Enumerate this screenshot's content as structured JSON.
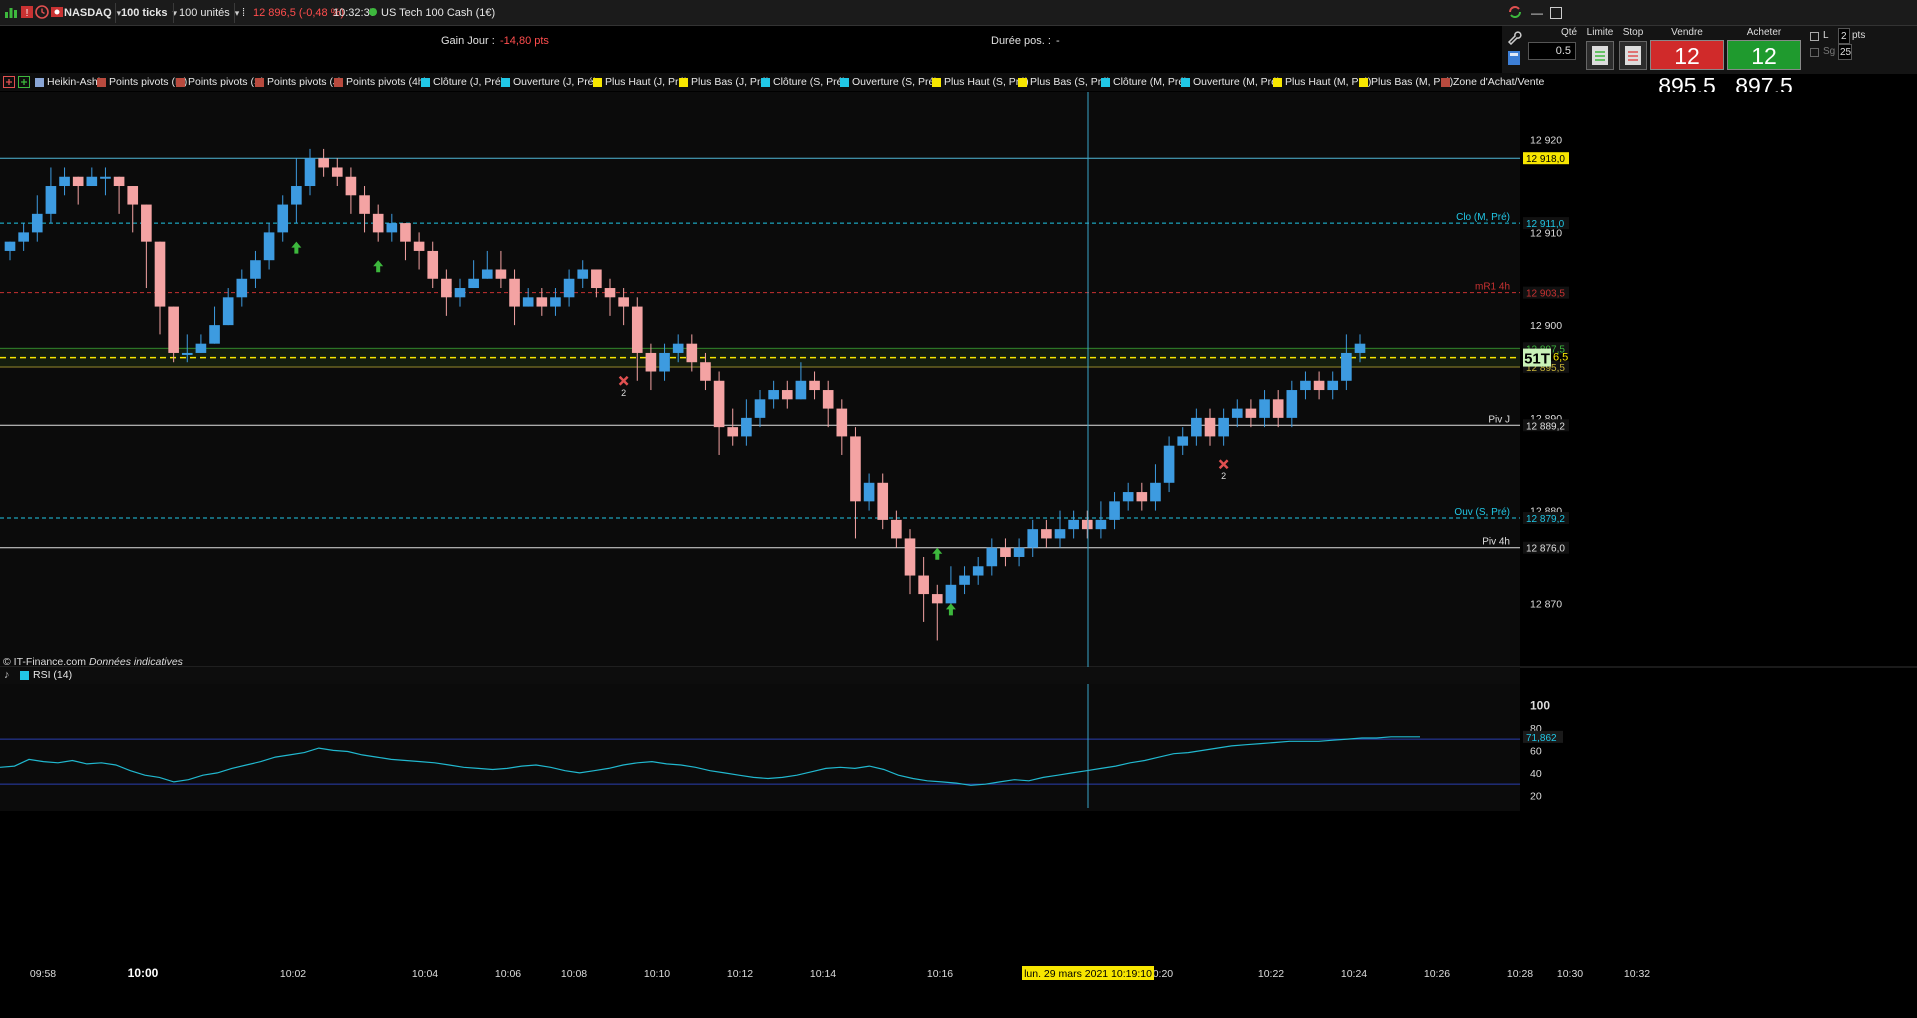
{
  "toolbar": {
    "instrument": "NASDAQ",
    "timeframe": "100 ticks",
    "units": "100 unités",
    "price_change": "12 896,5 (-0,48 %)",
    "clock": "10:32:37",
    "product_name": "US Tech 100 Cash (1€)"
  },
  "info": {
    "gain_label": "Gain Jour :",
    "gain_value": "-14,80 pts",
    "duration_label": "Durée pos. :",
    "duration_value": "-"
  },
  "order_panel": {
    "qty_label": "Qté",
    "qty_value": "0.5",
    "limit_label": "Limite",
    "stop_label": "Stop",
    "sell_label": "Vendre",
    "sell_price": "12 895,5",
    "buy_label": "Acheter",
    "buy_price": "12 897,5",
    "l_label": "L",
    "sg_label": "Sg",
    "pts_value": "2",
    "pts_label": "pts",
    "sg_value": "25"
  },
  "indicators": [
    {
      "label": "Heikin-Ashi",
      "color": "#8aa6d6"
    },
    {
      "label": "Points pivots (M)",
      "color": "#b84a3e"
    },
    {
      "label": "Points pivots (S)",
      "color": "#b84a3e"
    },
    {
      "label": "Points pivots (J)",
      "color": "#b84a3e"
    },
    {
      "label": "Points pivots (4h)",
      "color": "#b84a3e"
    },
    {
      "label": "Clôture (J, Pré)",
      "color": "#21c7e6"
    },
    {
      "label": "Ouverture (J, Pré)",
      "color": "#21c7e6"
    },
    {
      "label": "Plus Haut (J, Pré)",
      "color": "#f7e600"
    },
    {
      "label": "Plus Bas (J, Pré)",
      "color": "#f7e600"
    },
    {
      "label": "Clôture (S, Pré)",
      "color": "#21c7e6"
    },
    {
      "label": "Ouverture (S, Pré)",
      "color": "#21c7e6"
    },
    {
      "label": "Plus Haut (S, Pré)",
      "color": "#f7e600"
    },
    {
      "label": "Plus Bas (S, Pré)",
      "color": "#f7e600"
    },
    {
      "label": "Clôture (M, Pré)",
      "color": "#21c7e6"
    },
    {
      "label": "Ouverture (M, Pré)",
      "color": "#21c7e6"
    },
    {
      "label": "Plus Haut (M, Pré)",
      "color": "#f7e600"
    },
    {
      "label": "Plus Bas (M, Pré)",
      "color": "#f7e600"
    },
    {
      "label": "Zone d'Achat/Vente",
      "color": "#b84a3e"
    }
  ],
  "chart": {
    "copyright": "© IT-Finance.com",
    "disclaimer": "Données indicatives",
    "rsi_label": "RSI (14)",
    "crosshair_date": "lun. 29 mars 2021 10:19:10",
    "price_axis": [
      "12 920",
      "12 910",
      "12 900",
      "12 890",
      "12 880",
      "12 870"
    ],
    "price_ticks": [
      12920,
      12910,
      12900,
      12890,
      12880,
      12870
    ],
    "rsi_axis": [
      "100",
      "80",
      "60",
      "40",
      "20"
    ],
    "rsi_ticks": [
      100,
      80,
      60,
      40,
      20
    ],
    "rsi_current": "71,862",
    "time_axis": [
      "09:58",
      "10:00",
      "10:02",
      "10:04",
      "10:06",
      "10:08",
      "10:10",
      "10:12",
      "10:14",
      "10:16",
      "10:20",
      "10:22",
      "10:24",
      "10:26",
      "10:28",
      "10:30",
      "10:32"
    ],
    "levels": [
      {
        "label": "",
        "tag": "12 918,0",
        "value": 12918.0,
        "color": "#4fb8d6",
        "style": "solid",
        "tag_bg": "#f7e600",
        "tag_fg": "#000"
      },
      {
        "label": "Clo (M, Pré)",
        "tag": "12 911,0",
        "value": 12911.0,
        "color": "#21c7e6",
        "style": "dashed",
        "tag_bg": "#111",
        "tag_fg": "#21c7e6"
      },
      {
        "label": "mR1 4h",
        "tag": "12 903,5",
        "value": 12903.5,
        "color": "#c83232",
        "style": "dashed",
        "tag_bg": "#111",
        "tag_fg": "#c83232"
      },
      {
        "label": "",
        "tag": "12 897,5",
        "value": 12897.5,
        "color": "#3db83d",
        "style": "solid",
        "tag_bg": "#111",
        "tag_fg": "#3db83d"
      },
      {
        "label": "",
        "tag": "12 895,5",
        "value": 12895.5,
        "color": "#c8b43a",
        "style": "solid",
        "tag_bg": "#111",
        "tag_fg": "#c8b43a"
      },
      {
        "label": "Piv J",
        "tag": "12 889,2",
        "value": 12889.2,
        "color": "#e0e0e0",
        "style": "solid",
        "tag_bg": "#111",
        "tag_fg": "#e0e0e0"
      },
      {
        "label": "Ouv (S, Pré)",
        "tag": "12 879,2",
        "value": 12879.2,
        "color": "#21c7e6",
        "style": "dashed",
        "tag_bg": "#111",
        "tag_fg": "#21c7e6"
      },
      {
        "label": "Piv 4h",
        "tag": "12 876,0",
        "value": 12876.0,
        "color": "#e0e0e0",
        "style": "solid",
        "tag_bg": "#111",
        "tag_fg": "#e0e0e0"
      }
    ],
    "current_price_box": "51T",
    "current_price_suffix": "6,5",
    "current_price": 12896.5,
    "bull_color": "#3d9be0",
    "bear_color": "#f4a3a3",
    "candles": [
      [
        12908,
        12909,
        12909,
        12907
      ],
      [
        12909,
        12910,
        12911,
        12908
      ],
      [
        12910,
        12912,
        12914,
        12909
      ],
      [
        12912,
        12915,
        12917,
        12911
      ],
      [
        12915,
        12916,
        12917,
        12914
      ],
      [
        12916,
        12915,
        12916,
        12913
      ],
      [
        12915,
        12916,
        12917,
        12915
      ],
      [
        12916,
        12916,
        12917,
        12914
      ],
      [
        12916,
        12915,
        12916,
        12912
      ],
      [
        12915,
        12913,
        12915,
        12910
      ],
      [
        12913,
        12909,
        12913,
        12904
      ],
      [
        12909,
        12902,
        12909,
        12899
      ],
      [
        12902,
        12897,
        12902,
        12896
      ],
      [
        12897,
        12897,
        12899,
        12896
      ],
      [
        12897,
        12898,
        12899,
        12897
      ],
      [
        12898,
        12900,
        12902,
        12898
      ],
      [
        12900,
        12903,
        12904,
        12900
      ],
      [
        12903,
        12905,
        12906,
        12902
      ],
      [
        12905,
        12907,
        12908,
        12904
      ],
      [
        12907,
        12910,
        12911,
        12906
      ],
      [
        12910,
        12913,
        12914,
        12909
      ],
      [
        12913,
        12915,
        12918,
        12911
      ],
      [
        12915,
        12918,
        12919,
        12914
      ],
      [
        12918,
        12917,
        12919,
        12916
      ],
      [
        12917,
        12916,
        12918,
        12915
      ],
      [
        12916,
        12914,
        12917,
        12912
      ],
      [
        12914,
        12912,
        12915,
        12910
      ],
      [
        12912,
        12910,
        12913,
        12909
      ],
      [
        12910,
        12911,
        12912,
        12909
      ],
      [
        12911,
        12909,
        12911,
        12907
      ],
      [
        12909,
        12908,
        12910,
        12906
      ],
      [
        12908,
        12905,
        12909,
        12904
      ],
      [
        12905,
        12903,
        12906,
        12901
      ],
      [
        12903,
        12904,
        12905,
        12902
      ],
      [
        12904,
        12905,
        12907,
        12904
      ],
      [
        12905,
        12906,
        12908,
        12905
      ],
      [
        12906,
        12905,
        12908,
        12904
      ],
      [
        12905,
        12902,
        12906,
        12900
      ],
      [
        12902,
        12903,
        12904,
        12902
      ],
      [
        12903,
        12902,
        12904,
        12901
      ],
      [
        12902,
        12903,
        12904,
        12901
      ],
      [
        12903,
        12905,
        12906,
        12902
      ],
      [
        12905,
        12906,
        12907,
        12904
      ],
      [
        12906,
        12904,
        12906,
        12903
      ],
      [
        12904,
        12903,
        12905,
        12901
      ],
      [
        12903,
        12902,
        12904,
        12900
      ],
      [
        12902,
        12897,
        12903,
        12894
      ],
      [
        12897,
        12895,
        12898,
        12893
      ],
      [
        12895,
        12897,
        12898,
        12894
      ],
      [
        12897,
        12898,
        12899,
        12896
      ],
      [
        12898,
        12896,
        12899,
        12895
      ],
      [
        12896,
        12894,
        12897,
        12893
      ],
      [
        12894,
        12889,
        12895,
        12886
      ],
      [
        12889,
        12888,
        12891,
        12887
      ],
      [
        12888,
        12890,
        12892,
        12887
      ],
      [
        12890,
        12892,
        12893,
        12889
      ],
      [
        12892,
        12893,
        12894,
        12891
      ],
      [
        12893,
        12892,
        12894,
        12891
      ],
      [
        12892,
        12894,
        12896,
        12892
      ],
      [
        12894,
        12893,
        12895,
        12892
      ],
      [
        12893,
        12891,
        12894,
        12889
      ],
      [
        12891,
        12888,
        12892,
        12886
      ],
      [
        12888,
        12881,
        12889,
        12877
      ],
      [
        12881,
        12883,
        12884,
        12880
      ],
      [
        12883,
        12879,
        12884,
        12878
      ],
      [
        12879,
        12877,
        12880,
        12876
      ],
      [
        12877,
        12873,
        12878,
        12871
      ],
      [
        12873,
        12871,
        12875,
        12868
      ],
      [
        12871,
        12870,
        12872,
        12866
      ],
      [
        12870,
        12872,
        12874,
        12869
      ],
      [
        12872,
        12873,
        12874,
        12871
      ],
      [
        12873,
        12874,
        12875,
        12872
      ],
      [
        12874,
        12876,
        12877,
        12873
      ],
      [
        12876,
        12875,
        12877,
        12874
      ],
      [
        12875,
        12876,
        12877,
        12874
      ],
      [
        12876,
        12878,
        12879,
        12875
      ],
      [
        12878,
        12877,
        12879,
        12876
      ],
      [
        12877,
        12878,
        12880,
        12876
      ],
      [
        12878,
        12879,
        12880,
        12877
      ],
      [
        12879,
        12878,
        12880,
        12877
      ],
      [
        12878,
        12879,
        12881,
        12877
      ],
      [
        12879,
        12881,
        12882,
        12878
      ],
      [
        12881,
        12882,
        12883,
        12880
      ],
      [
        12882,
        12881,
        12883,
        12880
      ],
      [
        12881,
        12883,
        12885,
        12880
      ],
      [
        12883,
        12887,
        12888,
        12882
      ],
      [
        12887,
        12888,
        12889,
        12886
      ],
      [
        12888,
        12890,
        12891,
        12887
      ],
      [
        12890,
        12888,
        12891,
        12887
      ],
      [
        12888,
        12890,
        12891,
        12887
      ],
      [
        12890,
        12891,
        12892,
        12889
      ],
      [
        12891,
        12890,
        12892,
        12889
      ],
      [
        12890,
        12892,
        12893,
        12889
      ],
      [
        12892,
        12890,
        12893,
        12889
      ],
      [
        12890,
        12893,
        12894,
        12889
      ],
      [
        12893,
        12894,
        12895,
        12892
      ],
      [
        12894,
        12893,
        12895,
        12892
      ],
      [
        12893,
        12894,
        12895,
        12892
      ],
      [
        12894,
        12897,
        12899,
        12893
      ],
      [
        12897,
        12898,
        12899,
        12896
      ]
    ],
    "markers": [
      {
        "type": "up-arrow",
        "candle": 21,
        "price": 12909,
        "color": "#3db83d",
        "label": ""
      },
      {
        "type": "up-arrow",
        "candle": 27,
        "price": 12907,
        "color": "#3db83d",
        "label": ""
      },
      {
        "type": "x-mark",
        "candle": 45,
        "price": 12894,
        "color": "#e05050",
        "label": "2"
      },
      {
        "type": "up-arrow",
        "candle": 68,
        "price": 12876,
        "color": "#3db83d",
        "label": ""
      },
      {
        "type": "up-arrow",
        "candle": 69,
        "price": 12870,
        "color": "#3db83d",
        "label": ""
      },
      {
        "type": "x-mark",
        "candle": 89,
        "price": 12885,
        "color": "#e05050",
        "label": "2"
      }
    ],
    "rsi_values": [
      45,
      46,
      52,
      50,
      49,
      51,
      48,
      49,
      47,
      42,
      38,
      36,
      32,
      34,
      38,
      40,
      44,
      47,
      50,
      54,
      56,
      58,
      62,
      60,
      59,
      56,
      54,
      52,
      51,
      50,
      49,
      47,
      45,
      44,
      43,
      44,
      46,
      47,
      45,
      42,
      40,
      42,
      44,
      47,
      49,
      50,
      48,
      47,
      45,
      42,
      40,
      38,
      36,
      35,
      36,
      38,
      41,
      44,
      45,
      44,
      46,
      43,
      38,
      35,
      33,
      32,
      31,
      29,
      30,
      32,
      34,
      33,
      36,
      38,
      40,
      42,
      44,
      46,
      49,
      51,
      54,
      57,
      58,
      60,
      62,
      64,
      65,
      66,
      67,
      68,
      68,
      68,
      69,
      70,
      71,
      71,
      72,
      72,
      72
    ]
  }
}
